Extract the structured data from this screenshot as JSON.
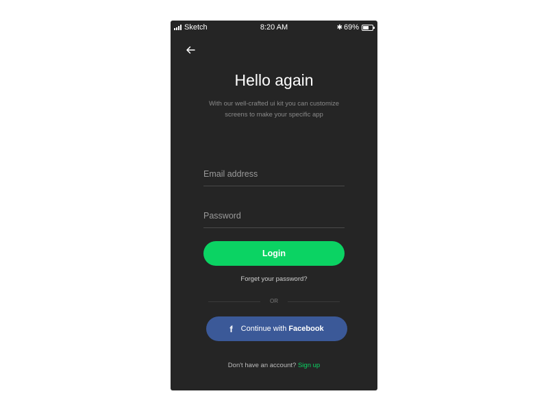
{
  "status_bar": {
    "carrier": "Sketch",
    "time": "8:20 AM",
    "battery": "69%",
    "battery_level": 0.69
  },
  "header": {
    "back_icon": "arrow-left-icon"
  },
  "title": "Hello again",
  "subtitle_line1": "With our well-crafted ui kit you can customize",
  "subtitle_line2": "screens to make your specific app",
  "form": {
    "email_placeholder": "Email address",
    "password_placeholder": "Password",
    "login_label": "Login",
    "forgot_label": "Forget your password?"
  },
  "divider_label": "OR",
  "facebook": {
    "icon": "f",
    "label_prefix": "Continue with",
    "label_bold": "Facebook"
  },
  "signup": {
    "prompt": "Don't have an account?",
    "link": "Sign up"
  },
  "colors": {
    "background": "#252525",
    "accent": "#0bd363",
    "facebook": "#3b5998"
  }
}
